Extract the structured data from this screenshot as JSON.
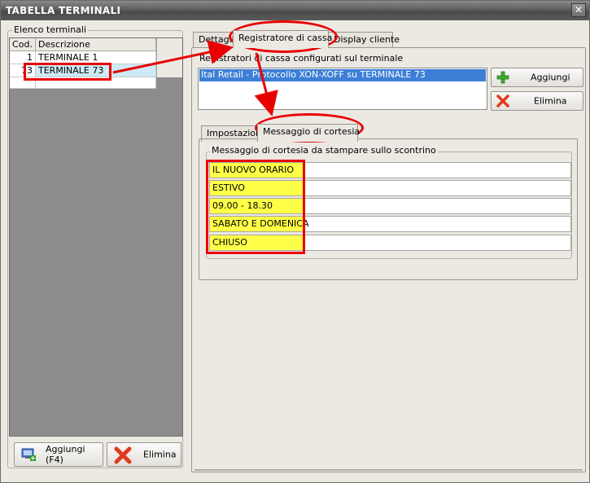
{
  "window": {
    "title": "TABELLA TERMINALI",
    "close_glyph": "✕"
  },
  "left": {
    "group_label": "Elenco terminali",
    "columns": {
      "cod": "Cod.",
      "desc": "Descrizione"
    },
    "rows": [
      {
        "cod": "1",
        "desc": "TERMINALE 1"
      },
      {
        "cod": "73",
        "desc": "TERMINALE 73"
      }
    ],
    "selected_row": 1,
    "add_button": "Aggiungi (F4)",
    "delete_button": "Elimina"
  },
  "tabs": [
    {
      "label": "Dettagli"
    },
    {
      "label": "Registratore di cassa"
    },
    {
      "label": "Display cliente"
    }
  ],
  "active_tab": 1,
  "register": {
    "label": "Registratori di cassa configurati sul terminale",
    "items": [
      "Ital Retail - Protocollo XON-XOFF su TERMINALE 73"
    ],
    "add_button": "Aggiungi",
    "delete_button": "Elimina"
  },
  "subtabs": [
    {
      "label": "Impostazioni"
    },
    {
      "label": "Messaggio di cortesia"
    }
  ],
  "active_subtab": 1,
  "courtesy": {
    "label": "Messaggio di cortesia da stampare sullo scontrino",
    "lines": [
      "IL NUOVO ORARIO",
      "ESTIVO",
      "09.00 - 18.30",
      "SABATO E DOMENICA",
      "CHIUSO"
    ]
  },
  "colors": {
    "annotation": "#e80000",
    "highlight": "#ffff47",
    "selection": "#3d7fd6"
  },
  "icons": {
    "add": "plus-icon",
    "delete": "x-icon",
    "add_terminal": "monitor-add-icon"
  }
}
